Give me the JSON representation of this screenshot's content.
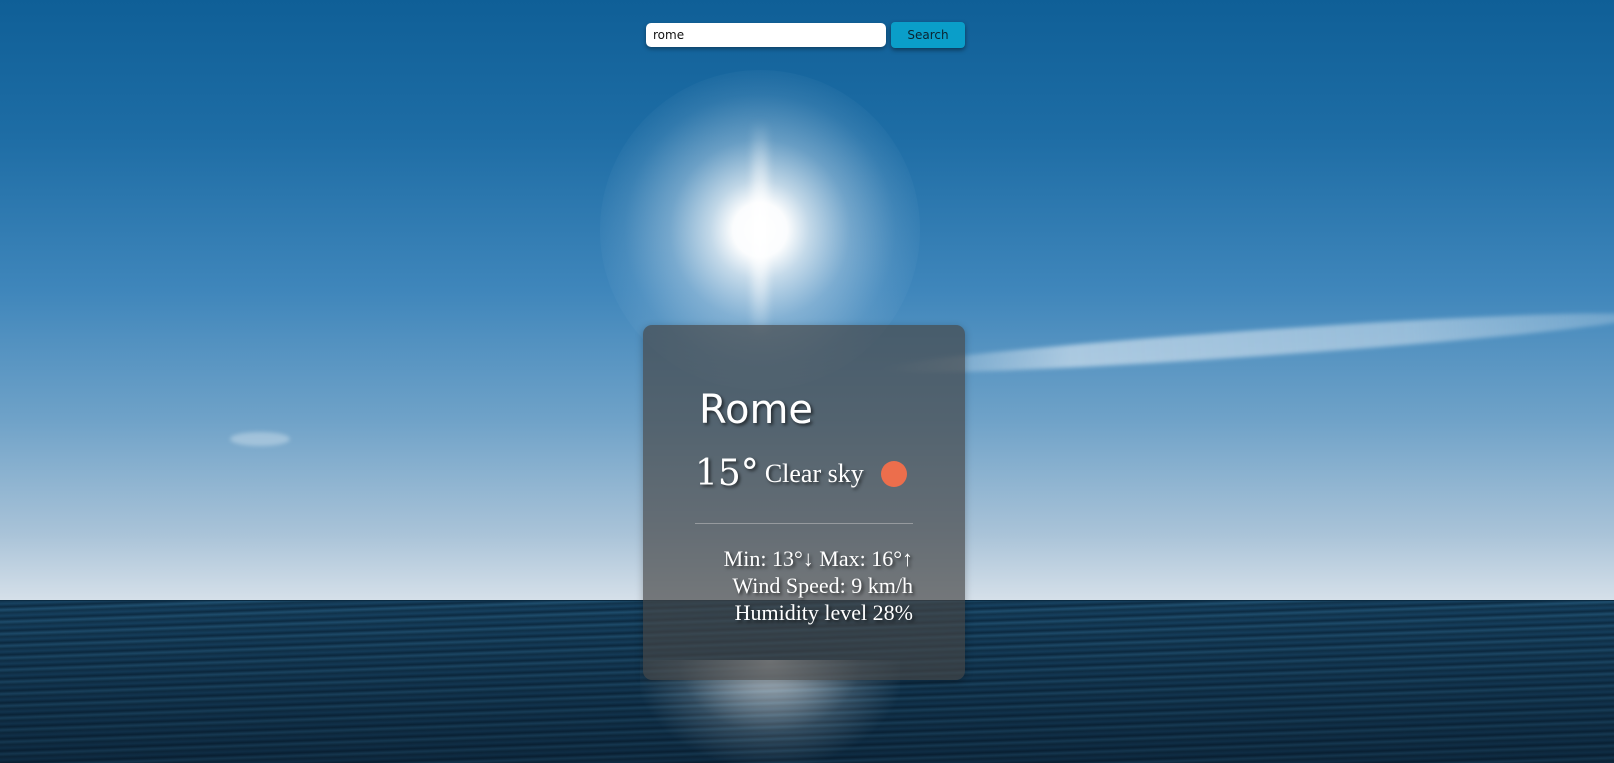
{
  "search": {
    "value": "rome",
    "button_label": "Search"
  },
  "weather": {
    "city": "Rome",
    "temperature": "15°",
    "condition": "Clear sky",
    "condition_icon": "sun-icon",
    "min_max": "Min: 13°↓ Max: 16°↑",
    "wind": "Wind Speed: 9 km/h",
    "humidity": "Humidity level 28%"
  },
  "colors": {
    "search_button": "#0a9ec9",
    "sun_dot": "#ec6e4c",
    "card_background": "rgba(70,70,70,0.68)"
  }
}
